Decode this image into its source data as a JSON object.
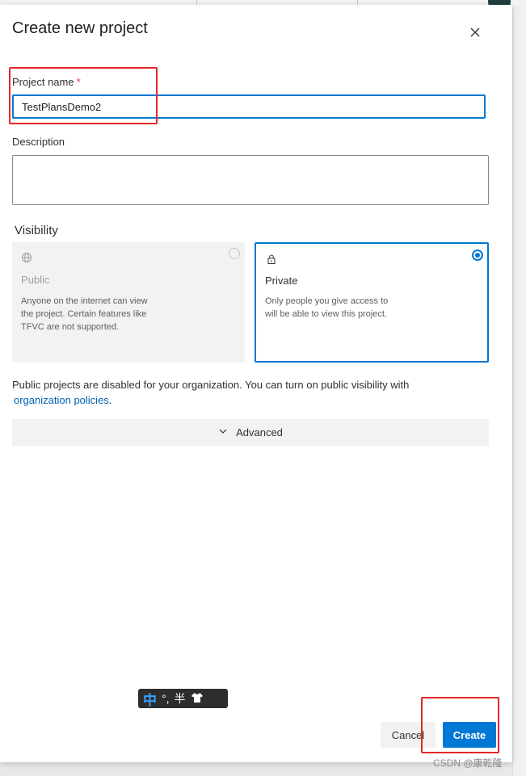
{
  "dialog": {
    "title": "Create new project",
    "close_icon": "close-icon"
  },
  "project_name": {
    "label": "Project name",
    "required_marker": "*",
    "value": "TestPlansDemo2"
  },
  "description": {
    "label": "Description",
    "value": ""
  },
  "visibility": {
    "label": "Visibility",
    "options": [
      {
        "icon": "globe-icon",
        "title": "Public",
        "description": "Anyone on the internet can view the project. Certain features like TFVC are not supported.",
        "selected": false,
        "disabled": true
      },
      {
        "icon": "lock-icon",
        "title": "Private",
        "description": "Only people you give access to will be able to view this project.",
        "selected": true,
        "disabled": false
      }
    ]
  },
  "notice": {
    "text": "Public projects are disabled for your organization. You can turn on public visibility with",
    "link": "organization policies",
    "suffix": "."
  },
  "advanced": {
    "label": "Advanced",
    "icon": "chevron-down-icon"
  },
  "ime_toolbar": {
    "mode": "中",
    "punct": "°,",
    "width": "半",
    "icon": "shirt-icon"
  },
  "buttons": {
    "cancel": "Cancel",
    "create": "Create"
  },
  "watermark": "CSDN @康乾隆",
  "colors": {
    "accent": "#0078d4",
    "highlight": "#e8262a",
    "required": "#d13438"
  }
}
